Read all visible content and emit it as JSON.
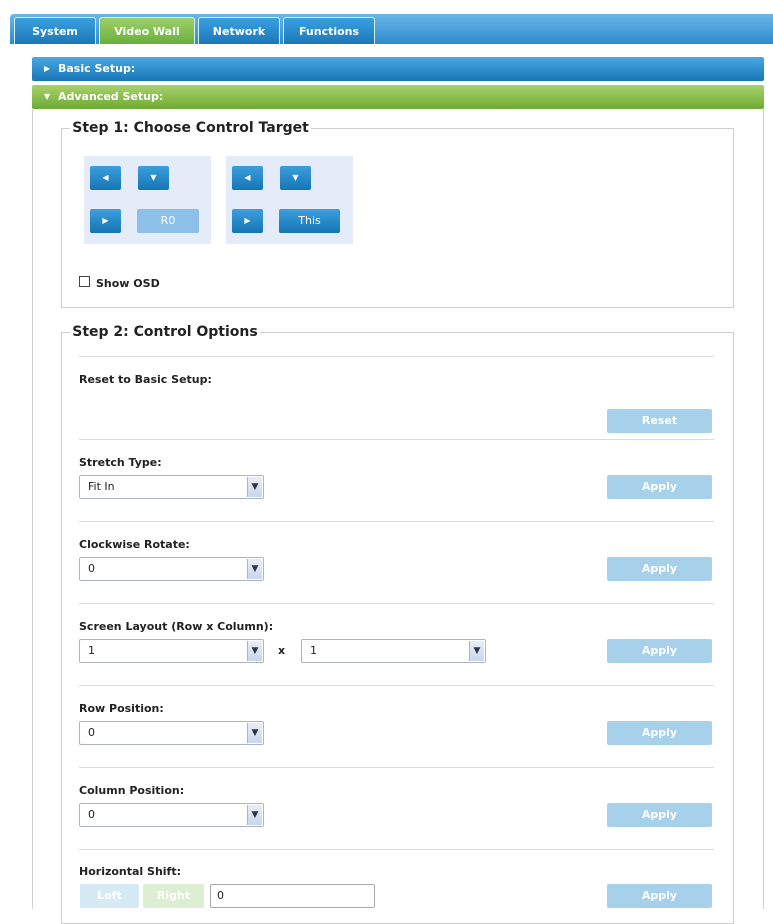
{
  "tabs": [
    {
      "label": "System"
    },
    {
      "label": "Video Wall"
    },
    {
      "label": "Network"
    },
    {
      "label": "Functions"
    }
  ],
  "panels": {
    "basic": "Basic Setup:",
    "advanced": "Advanced Setup:"
  },
  "step1": {
    "title": "Step 1: Choose Control Target",
    "target1": "R0",
    "target2": "This",
    "show_osd": "Show OSD"
  },
  "step2": {
    "title": "Step 2: Control Options",
    "reset_label": "Reset to Basic Setup:",
    "reset_button": "Reset",
    "stretch_label": "Stretch Type:",
    "stretch_value": "Fit In",
    "rotate_label": "Clockwise Rotate:",
    "rotate_value": "0",
    "layout_label": "Screen Layout (Row x Column):",
    "layout_row": "1",
    "layout_x": "x",
    "layout_col": "1",
    "rowpos_label": "Row Position:",
    "rowpos_value": "0",
    "colpos_label": "Column Position:",
    "colpos_value": "0",
    "hshift_label": "Horizontal Shift:",
    "hshift_left": "Left",
    "hshift_right": "Right",
    "hshift_value": "0",
    "apply": "Apply"
  }
}
